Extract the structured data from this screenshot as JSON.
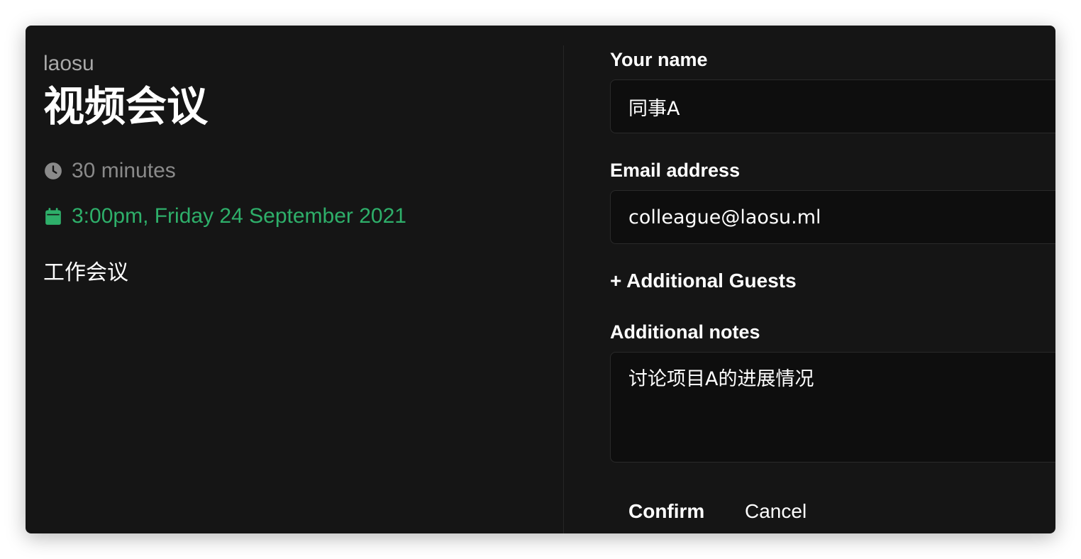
{
  "event": {
    "organizer": "laosu",
    "title": "视频会议",
    "duration": "30 minutes",
    "datetime": "3:00pm, Friday 24 September 2021",
    "description": "工作会议"
  },
  "form": {
    "name_label": "Your name",
    "name_value": "同事A",
    "email_label": "Email address",
    "email_value": "colleague@laosu.ml",
    "guests_link": "+ Additional Guests",
    "notes_label": "Additional notes",
    "notes_value": "讨论项目A的进展情况",
    "confirm_label": "Confirm",
    "cancel_label": "Cancel"
  },
  "icons": {
    "duration": "clock-icon",
    "datetime": "calendar-icon"
  },
  "colors": {
    "card_bg": "#151515",
    "accent_green": "#2eaf6a",
    "muted_text": "#8a8a8a",
    "input_bg": "#0e0e0e"
  }
}
